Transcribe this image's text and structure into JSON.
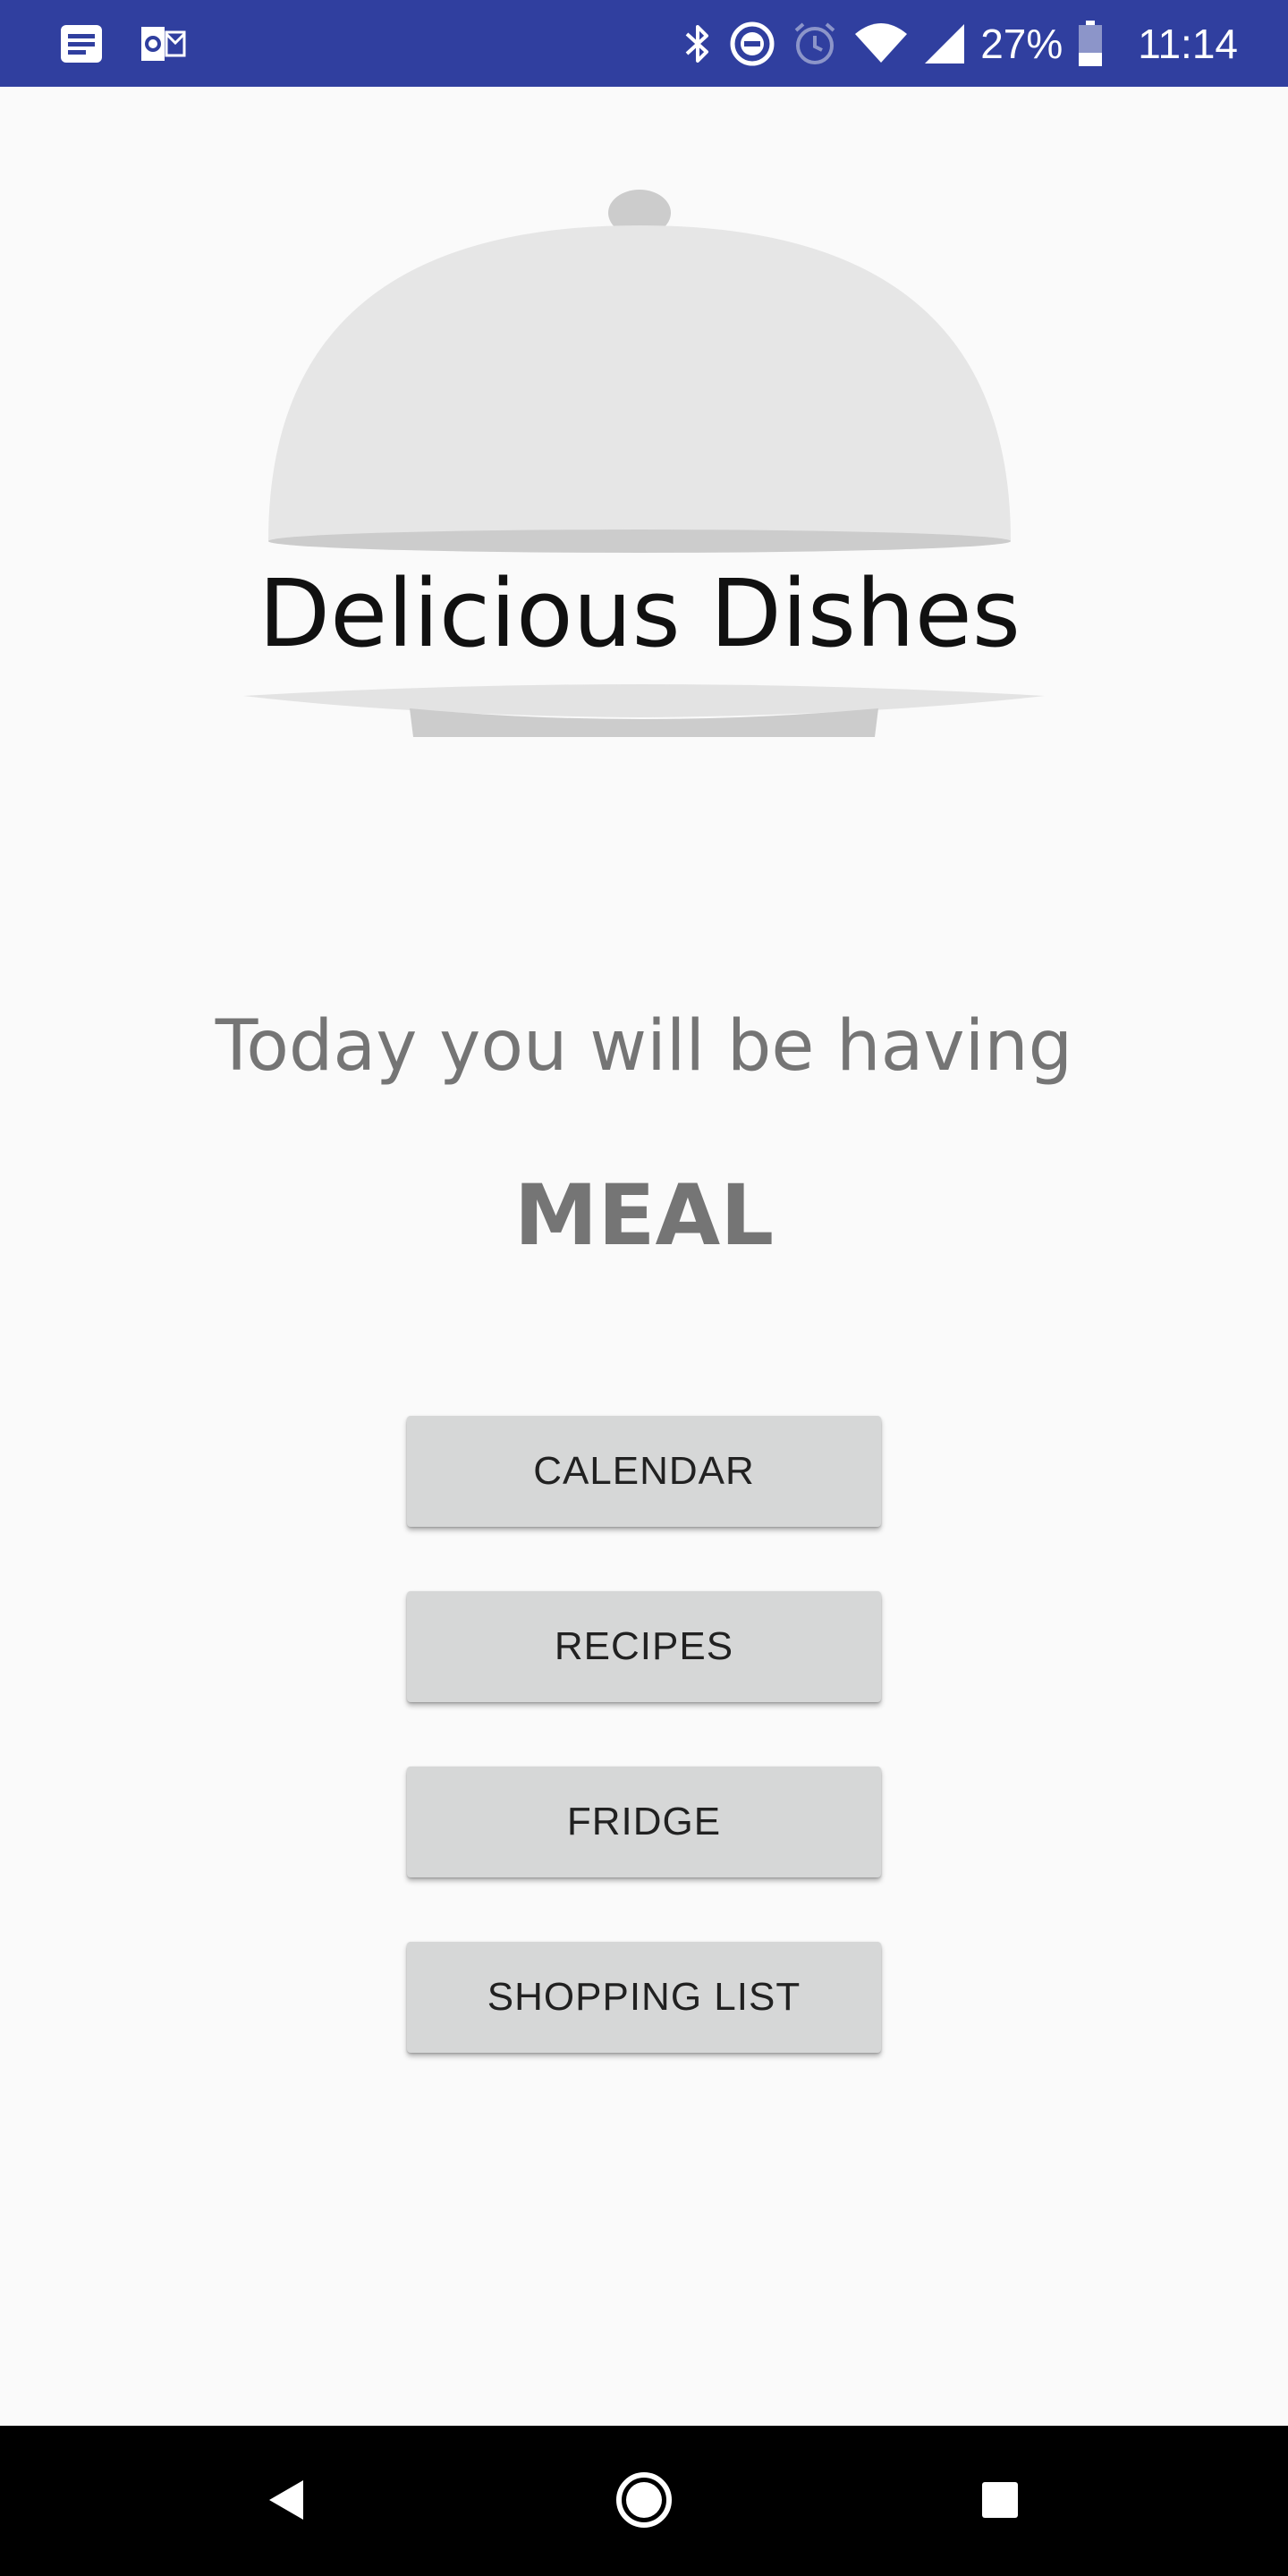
{
  "status_bar": {
    "battery": "27%",
    "time": "11:14",
    "background": "#303f9f",
    "left_icons": [
      "news-icon",
      "outlook-icon"
    ],
    "right_icons": [
      "bluetooth-icon",
      "do-not-disturb-icon",
      "alarm-icon",
      "wifi-icon",
      "signal-icon",
      "battery-icon"
    ]
  },
  "logo": {
    "text": "Delicious Dishes"
  },
  "main": {
    "headline": "Today you will be having",
    "meal": "MEAL"
  },
  "buttons": {
    "calendar": "CALENDAR",
    "recipes": "RECIPES",
    "fridge": "FRIDGE",
    "shopping_list": "SHOPPING LIST"
  },
  "nav_bar": {
    "icons": [
      "back-icon",
      "home-icon",
      "recents-icon"
    ]
  }
}
